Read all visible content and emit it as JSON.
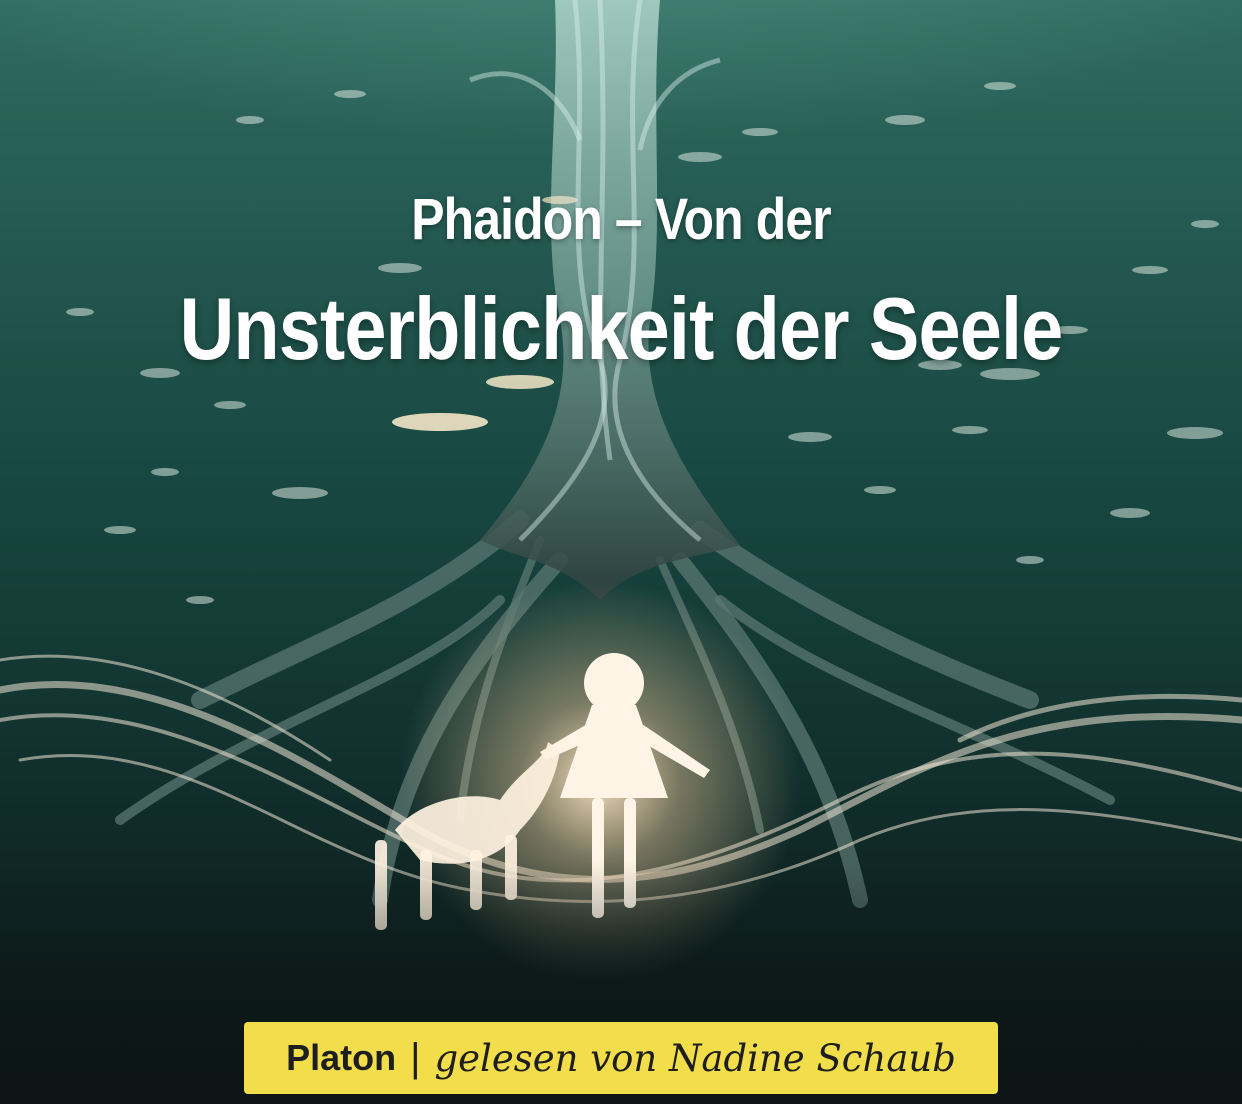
{
  "cover": {
    "title_line1": "Phaidon – Von der",
    "title_line2": "Unsterblichkeit der Seele",
    "author": "Platon",
    "separator": "|",
    "reader": "gelesen von Nadine Schaub"
  },
  "colors": {
    "water_top": "#2f6a60",
    "water_mid": "#143a36",
    "water_bottom": "#0b1616",
    "badge": "#f2de4a",
    "badge_text": "#1e1e1e",
    "title": "#ffffff"
  }
}
